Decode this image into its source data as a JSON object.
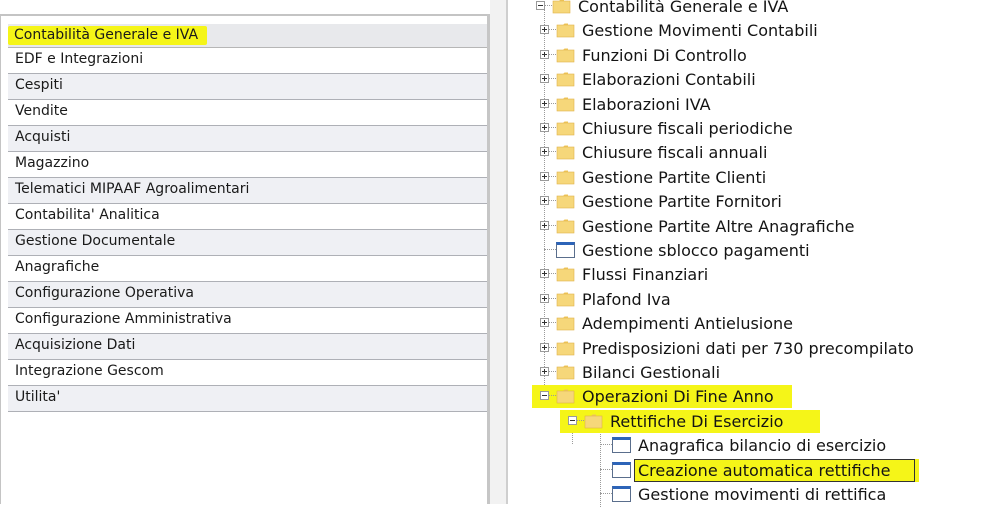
{
  "modules": {
    "items": [
      {
        "label": "Contabilità Generale e IVA",
        "state": "selected",
        "highlighted": true
      },
      {
        "label": "EDF e Integrazioni",
        "state": "white"
      },
      {
        "label": "Cespiti",
        "state": "shaded"
      },
      {
        "label": "Vendite",
        "state": "white"
      },
      {
        "label": "Acquisti",
        "state": "shaded"
      },
      {
        "label": "Magazzino",
        "state": "white"
      },
      {
        "label": "Telematici MIPAAF Agroalimentari",
        "state": "shaded"
      },
      {
        "label": "Contabilita' Analitica",
        "state": "white"
      },
      {
        "label": "Gestione Documentale",
        "state": "shaded"
      },
      {
        "label": "Anagrafiche",
        "state": "white"
      },
      {
        "label": "Configurazione Operativa",
        "state": "shaded"
      },
      {
        "label": "Configurazione Amministrativa",
        "state": "white"
      },
      {
        "label": "Acquisizione Dati",
        "state": "shaded"
      },
      {
        "label": "Integrazione Gescom",
        "state": "white"
      },
      {
        "label": "Utilita'",
        "state": "shaded"
      }
    ]
  },
  "tree": {
    "nodes": [
      {
        "label": "Contabilità Generale e IVA",
        "level": 0,
        "icon": "folder",
        "expander": "minus",
        "clipped": true
      },
      {
        "label": "Gestione Movimenti Contabili",
        "level": 1,
        "icon": "folder",
        "expander": "plus"
      },
      {
        "label": "Funzioni Di Controllo",
        "level": 1,
        "icon": "folder",
        "expander": "plus"
      },
      {
        "label": "Elaborazioni Contabili",
        "level": 1,
        "icon": "folder",
        "expander": "plus"
      },
      {
        "label": "Elaborazioni IVA",
        "level": 1,
        "icon": "folder",
        "expander": "plus"
      },
      {
        "label": "Chiusure fiscali periodiche",
        "level": 1,
        "icon": "folder",
        "expander": "plus"
      },
      {
        "label": "Chiusure fiscali annuali",
        "level": 1,
        "icon": "folder",
        "expander": "plus"
      },
      {
        "label": "Gestione Partite Clienti",
        "level": 1,
        "icon": "folder",
        "expander": "plus"
      },
      {
        "label": "Gestione Partite Fornitori",
        "level": 1,
        "icon": "folder",
        "expander": "plus"
      },
      {
        "label": "Gestione Partite Altre Anagrafiche",
        "level": 1,
        "icon": "folder",
        "expander": "plus"
      },
      {
        "label": "Gestione sblocco pagamenti",
        "level": 1,
        "icon": "document",
        "expander": "none"
      },
      {
        "label": "Flussi Finanziari",
        "level": 1,
        "icon": "folder",
        "expander": "plus"
      },
      {
        "label": "Plafond Iva",
        "level": 1,
        "icon": "folder",
        "expander": "plus"
      },
      {
        "label": "Adempimenti Antielusione",
        "level": 1,
        "icon": "folder",
        "expander": "plus"
      },
      {
        "label": "Predisposizioni dati per 730 precompilato",
        "level": 1,
        "icon": "folder",
        "expander": "plus"
      },
      {
        "label": "Bilanci Gestionali",
        "level": 1,
        "icon": "folder",
        "expander": "plus"
      },
      {
        "label": "Operazioni Di Fine Anno",
        "level": 1,
        "icon": "folder",
        "expander": "minus",
        "highlighted": true
      },
      {
        "label": "Rettifiche Di Esercizio",
        "level": 2,
        "icon": "folder",
        "expander": "minus",
        "highlighted": true
      },
      {
        "label": "Anagrafica bilancio di esercizio",
        "level": 3,
        "icon": "document",
        "expander": "none"
      },
      {
        "label": "Creazione automatica rettifiche",
        "level": 3,
        "icon": "document",
        "expander": "none",
        "highlighted": true,
        "selected": true
      },
      {
        "label": "Gestione movimenti di rettifica",
        "level": 3,
        "icon": "document",
        "expander": "none"
      }
    ]
  },
  "colors": {
    "highlight": "#f5f518",
    "row_shaded": "#eff0f4",
    "row_border": "#aeb0b6",
    "folder_fill": "#f6d77a",
    "document_header": "#2d64b8",
    "selection_border": "#333333"
  },
  "icons": {
    "folder": "folder-icon",
    "document": "document-icon",
    "expand": "tree-expand-plus-icon",
    "collapse": "tree-collapse-minus-icon"
  }
}
